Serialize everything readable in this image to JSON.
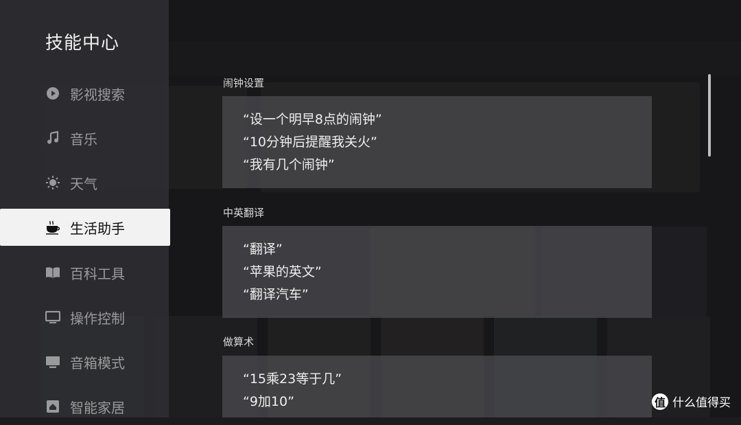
{
  "sidebar": {
    "title": "技能中心",
    "items": [
      {
        "label": "影视搜索",
        "icon": "play-circle-icon",
        "active": false
      },
      {
        "label": "音乐",
        "icon": "music-note-icon",
        "active": false
      },
      {
        "label": "天气",
        "icon": "sun-icon",
        "active": false
      },
      {
        "label": "生活助手",
        "icon": "coffee-cup-icon",
        "active": true
      },
      {
        "label": "百科工具",
        "icon": "book-icon",
        "active": false
      },
      {
        "label": "操作控制",
        "icon": "monitor-icon",
        "active": false
      },
      {
        "label": "音箱模式",
        "icon": "speaker-screen-icon",
        "active": false
      },
      {
        "label": "智能家居",
        "icon": "smart-home-icon",
        "active": false
      }
    ]
  },
  "sections": [
    {
      "title": "闹钟设置",
      "lines": [
        "“设一个明早8点的闹钟”",
        "“10分钟后提醒我关火”",
        "“我有几个闹钟”"
      ]
    },
    {
      "title": "中英翻译",
      "lines": [
        "“翻译”",
        "“苹果的英文”",
        "“翻译汽车”"
      ]
    },
    {
      "title": "做算术",
      "lines": [
        "“15乘23等于几”",
        "“9加10”"
      ]
    }
  ],
  "watermark": {
    "logo": "值",
    "text": "什么值得买"
  },
  "colors": {
    "active_bg": "#f2f2f2",
    "sidebar_bg": "#303034",
    "card_bg": "#4e4e52"
  }
}
